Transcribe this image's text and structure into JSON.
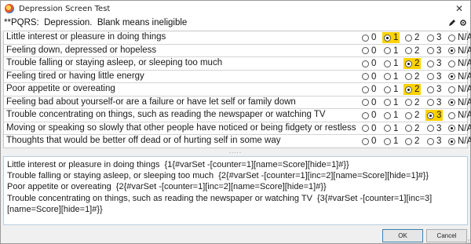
{
  "window": {
    "title": "Depression Screen Test"
  },
  "header": {
    "text": "**PQRS:  Depression.  Blank means ineligible"
  },
  "options": [
    "0",
    "1",
    "2",
    "3",
    "N/A"
  ],
  "rows": [
    {
      "label": "Little interest or pleasure in doing things",
      "selected": 1
    },
    {
      "label": "Feeling down, depressed or hopeless",
      "selected": 4
    },
    {
      "label": "Trouble falling or staying asleep, or sleeping too much",
      "selected": 2
    },
    {
      "label": "Feeling tired or having little energy",
      "selected": 4
    },
    {
      "label": "Poor appetite or overeating",
      "selected": 2
    },
    {
      "label": "Feeling bad about yourself-or are a failure or have let self or family down",
      "selected": 4
    },
    {
      "label": "Trouble concentrating on things, such as reading the newspaper or watching TV",
      "selected": 3
    },
    {
      "label": "Moving or speaking so slowly that other people have noticed or being fidgety or restless",
      "selected": 4
    },
    {
      "label": "Thoughts that would be better off dead or of hurting self in some way",
      "selected": 4
    }
  ],
  "highlight_color": "#ffd200",
  "output": {
    "lines": [
      "Little interest or pleasure in doing things  {1{#varSet -[counter=1][name=Score][hide=1]#}}",
      "Trouble falling or staying asleep, or sleeping too much  {2{#varSet -[counter=1][inc=2][name=Score][hide=1]#}}",
      "Poor appetite or overeating  {2{#varSet -[counter=1][inc=2][name=Score][hide=1]#}}",
      "Trouble concentrating on things, such as reading the newspaper or watching TV  {3{#varSet -[counter=1][inc=3][name=Score][hide=1]#}}"
    ]
  },
  "footer": {
    "ok_label": "OK",
    "cancel_label": "Cancel"
  }
}
